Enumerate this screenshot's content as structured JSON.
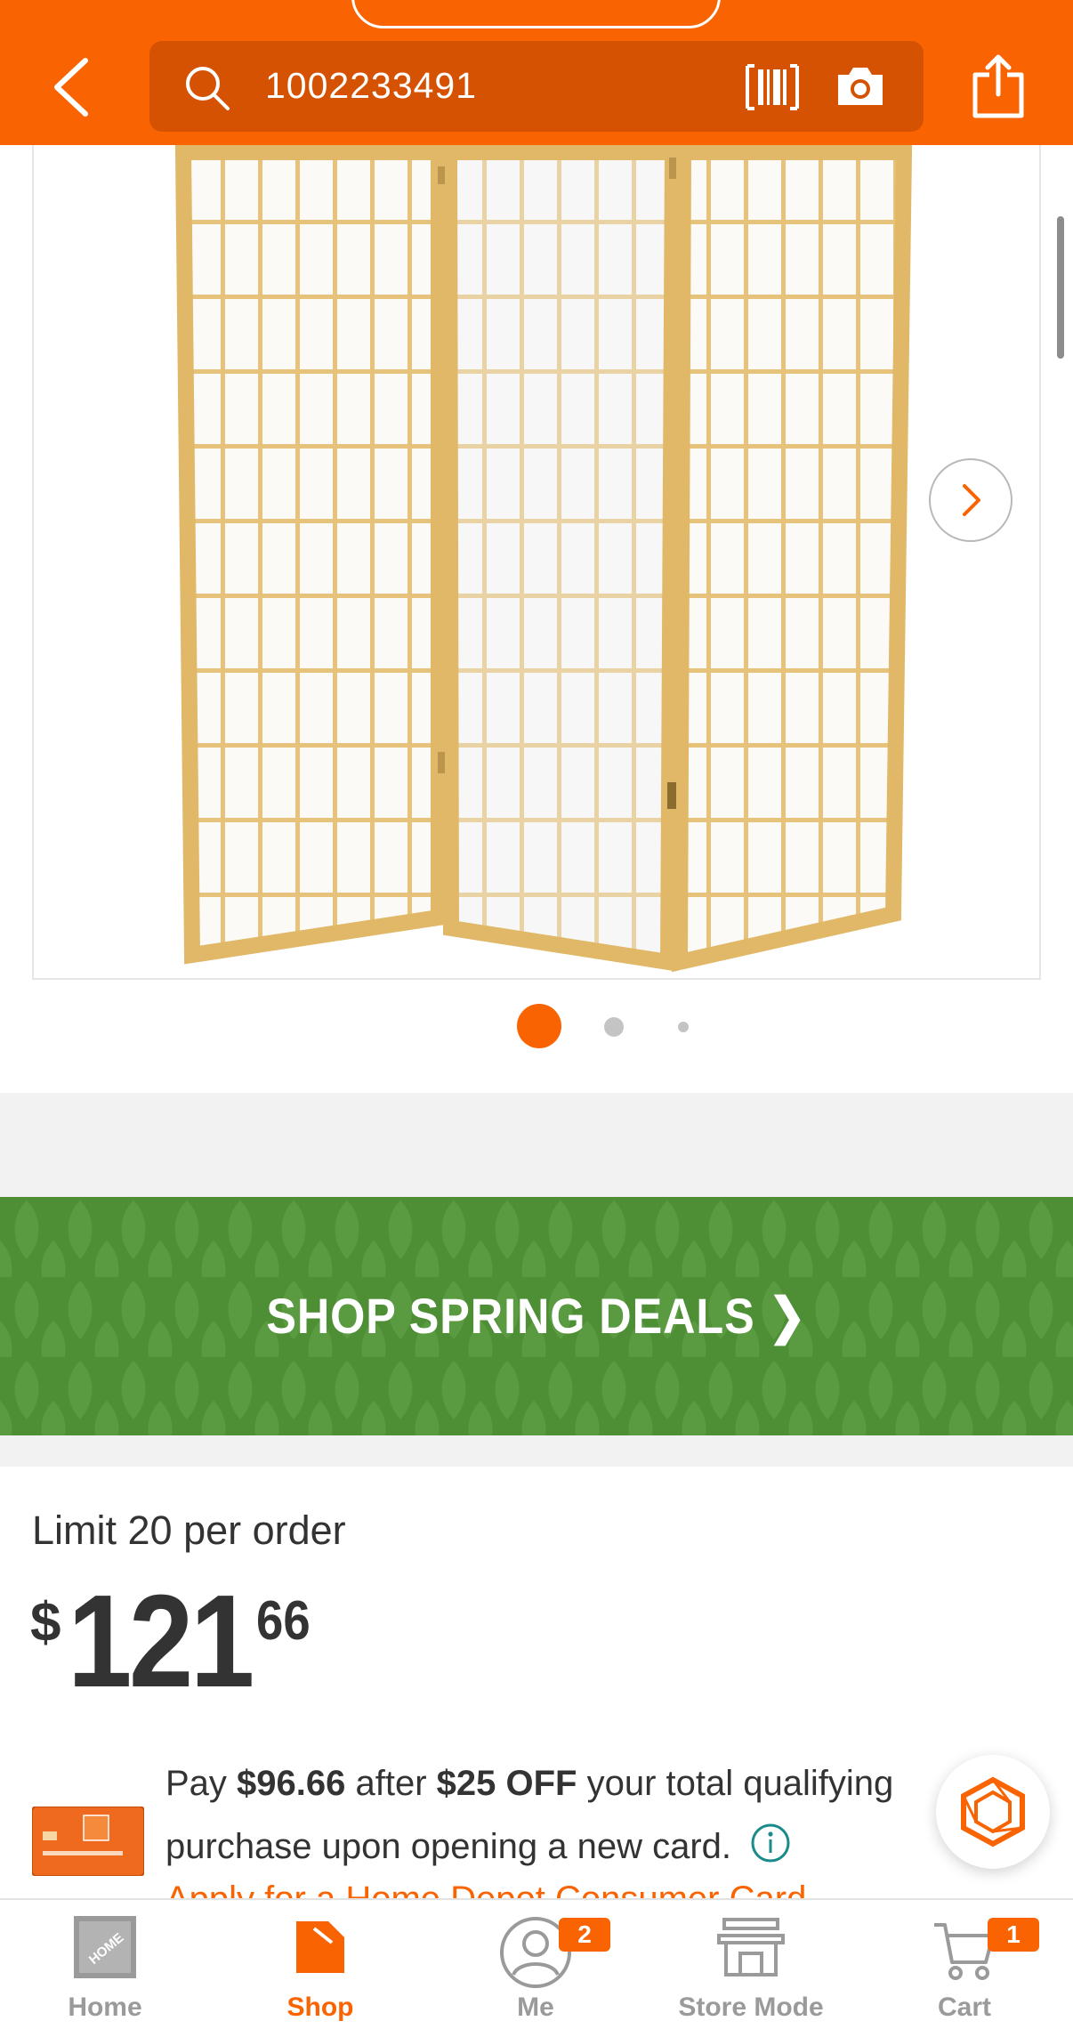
{
  "header": {
    "search_value": "1002233491",
    "icons": [
      "back-arrow-icon",
      "search-icon",
      "barcode-scan-icon",
      "camera-icon",
      "share-icon"
    ]
  },
  "gallery": {
    "image_count": 3,
    "active_index": 1
  },
  "banner": {
    "label": "SHOP SPRING DEALS ❯"
  },
  "pricing": {
    "limit": "Limit 20 per order",
    "currency": "$",
    "dollars": "121",
    "cents": "66"
  },
  "promo": {
    "prefix": "Pay ",
    "after_price": "$96.66",
    "mid": " after ",
    "discount": "$25 OFF",
    "suffix": " your total qualifying",
    "line2": "purchase upon opening a new card.",
    "link": "Apply for a Home Depot Consumer Card"
  },
  "tabbar": {
    "tabs": [
      {
        "label": "Home",
        "icon": "home-depot-logo-icon"
      },
      {
        "label": "Shop",
        "icon": "shop-tag-icon"
      },
      {
        "label": "Me",
        "icon": "person-icon",
        "badge": "2"
      },
      {
        "label": "Store Mode",
        "icon": "store-icon"
      },
      {
        "label": "Cart",
        "icon": "cart-icon",
        "badge": "1"
      }
    ],
    "active": "Shop"
  },
  "colors": {
    "brand_orange": "#f96302",
    "banner_green": "#4e8f36",
    "text_dark": "#333333",
    "inactive_gray": "#9a9a9a"
  }
}
